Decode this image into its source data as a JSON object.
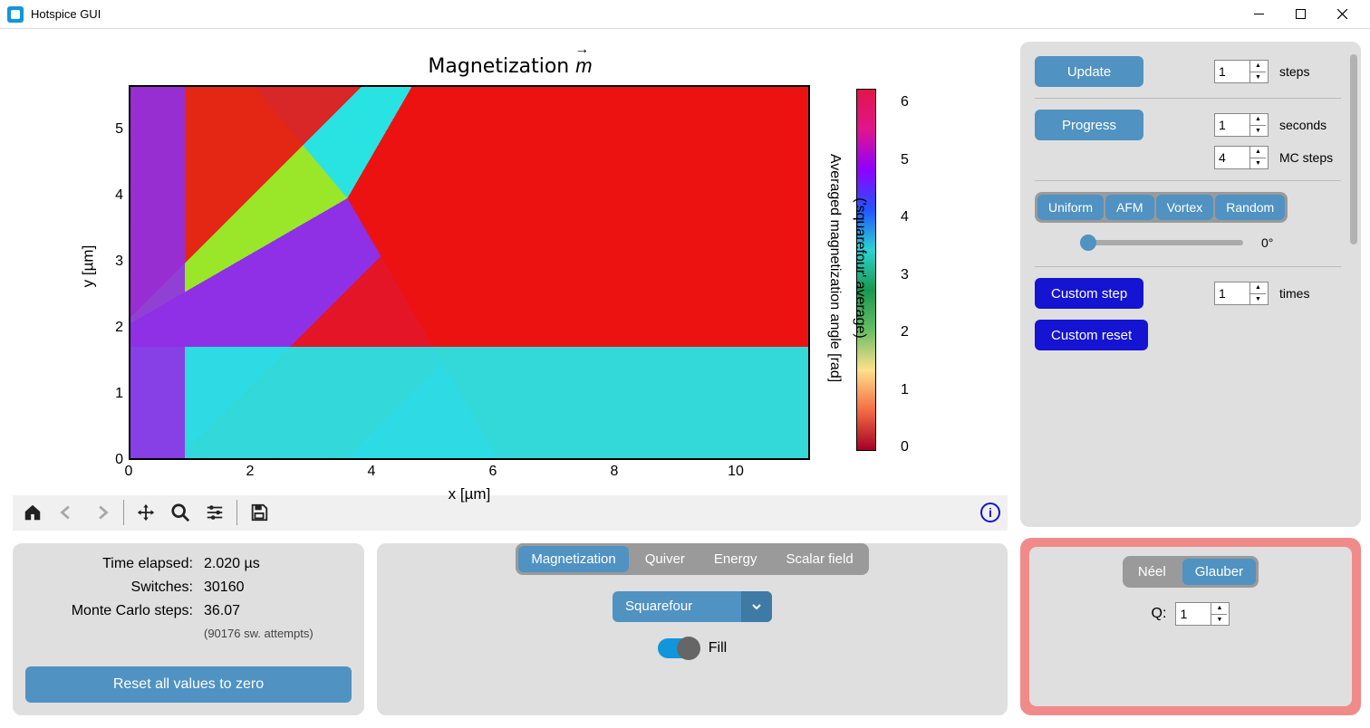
{
  "window": {
    "title": "Hotspice GUI"
  },
  "chart_data": {
    "type": "heatmap",
    "title": "Magnetization m⃗",
    "xlabel": "x [µm]",
    "ylabel": "y [µm]",
    "xticks": [
      0,
      2,
      4,
      6,
      8,
      10
    ],
    "yticks": [
      0,
      1,
      2,
      3,
      4,
      5
    ],
    "xlim": [
      0,
      11.2
    ],
    "ylim": [
      0,
      5.5
    ],
    "colorbar": {
      "label": "Averaged magnetization angle [rad]",
      "sublabel": "('squarefour' average)",
      "ticks": [
        0,
        1,
        2,
        3,
        4,
        5,
        6
      ],
      "range": [
        0,
        6.28
      ]
    },
    "note": "2-D domain map; per-pixel angle values not individually readable"
  },
  "toolbar": {
    "info_tooltip": "About"
  },
  "stats": {
    "time_label": "Time elapsed:",
    "time_value": "2.020 µs",
    "switches_label": "Switches:",
    "switches_value": "30160",
    "mc_label": "Monte Carlo steps:",
    "mc_value": "36.07",
    "attempts": "(90176 sw. attempts)",
    "reset": "Reset all values to zero"
  },
  "view": {
    "tabs": [
      "Magnetization",
      "Quiver",
      "Energy",
      "Scalar field"
    ],
    "active_tab": "Magnetization",
    "dropdown": "Squarefour",
    "fill_label": "Fill"
  },
  "controls": {
    "update": "Update",
    "steps_label": "steps",
    "steps_value": "1",
    "progress": "Progress",
    "seconds_label": "seconds",
    "seconds_value": "1",
    "mcsteps_label": "MC steps",
    "mcsteps_value": "4",
    "init_modes": [
      "Uniform",
      "AFM",
      "Vortex",
      "Random"
    ],
    "angle_label": "0°",
    "custom_step": "Custom step",
    "times_label": "times",
    "times_value": "1",
    "custom_reset": "Custom reset"
  },
  "scheme": {
    "modes": [
      "Néel",
      "Glauber"
    ],
    "active": "Glauber",
    "q_label": "Q:",
    "q_value": "1"
  }
}
